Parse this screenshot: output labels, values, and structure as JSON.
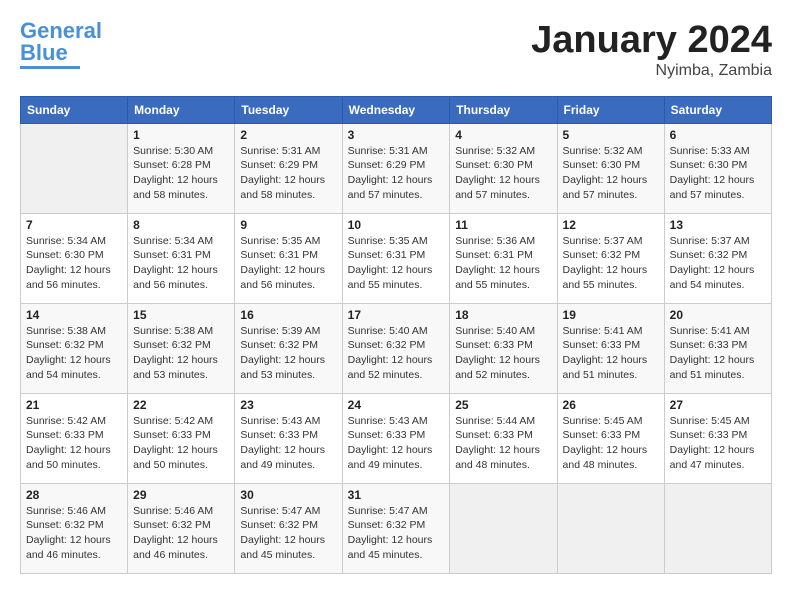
{
  "logo": {
    "line1": "General",
    "line2": "Blue"
  },
  "title": "January 2024",
  "subtitle": "Nyimba, Zambia",
  "headers": [
    "Sunday",
    "Monday",
    "Tuesday",
    "Wednesday",
    "Thursday",
    "Friday",
    "Saturday"
  ],
  "weeks": [
    [
      {
        "day": "",
        "info": ""
      },
      {
        "day": "1",
        "info": "Sunrise: 5:30 AM\nSunset: 6:28 PM\nDaylight: 12 hours\nand 58 minutes."
      },
      {
        "day": "2",
        "info": "Sunrise: 5:31 AM\nSunset: 6:29 PM\nDaylight: 12 hours\nand 58 minutes."
      },
      {
        "day": "3",
        "info": "Sunrise: 5:31 AM\nSunset: 6:29 PM\nDaylight: 12 hours\nand 57 minutes."
      },
      {
        "day": "4",
        "info": "Sunrise: 5:32 AM\nSunset: 6:30 PM\nDaylight: 12 hours\nand 57 minutes."
      },
      {
        "day": "5",
        "info": "Sunrise: 5:32 AM\nSunset: 6:30 PM\nDaylight: 12 hours\nand 57 minutes."
      },
      {
        "day": "6",
        "info": "Sunrise: 5:33 AM\nSunset: 6:30 PM\nDaylight: 12 hours\nand 57 minutes."
      }
    ],
    [
      {
        "day": "7",
        "info": "Sunrise: 5:34 AM\nSunset: 6:30 PM\nDaylight: 12 hours\nand 56 minutes."
      },
      {
        "day": "8",
        "info": "Sunrise: 5:34 AM\nSunset: 6:31 PM\nDaylight: 12 hours\nand 56 minutes."
      },
      {
        "day": "9",
        "info": "Sunrise: 5:35 AM\nSunset: 6:31 PM\nDaylight: 12 hours\nand 56 minutes."
      },
      {
        "day": "10",
        "info": "Sunrise: 5:35 AM\nSunset: 6:31 PM\nDaylight: 12 hours\nand 55 minutes."
      },
      {
        "day": "11",
        "info": "Sunrise: 5:36 AM\nSunset: 6:31 PM\nDaylight: 12 hours\nand 55 minutes."
      },
      {
        "day": "12",
        "info": "Sunrise: 5:37 AM\nSunset: 6:32 PM\nDaylight: 12 hours\nand 55 minutes."
      },
      {
        "day": "13",
        "info": "Sunrise: 5:37 AM\nSunset: 6:32 PM\nDaylight: 12 hours\nand 54 minutes."
      }
    ],
    [
      {
        "day": "14",
        "info": "Sunrise: 5:38 AM\nSunset: 6:32 PM\nDaylight: 12 hours\nand 54 minutes."
      },
      {
        "day": "15",
        "info": "Sunrise: 5:38 AM\nSunset: 6:32 PM\nDaylight: 12 hours\nand 53 minutes."
      },
      {
        "day": "16",
        "info": "Sunrise: 5:39 AM\nSunset: 6:32 PM\nDaylight: 12 hours\nand 53 minutes."
      },
      {
        "day": "17",
        "info": "Sunrise: 5:40 AM\nSunset: 6:32 PM\nDaylight: 12 hours\nand 52 minutes."
      },
      {
        "day": "18",
        "info": "Sunrise: 5:40 AM\nSunset: 6:33 PM\nDaylight: 12 hours\nand 52 minutes."
      },
      {
        "day": "19",
        "info": "Sunrise: 5:41 AM\nSunset: 6:33 PM\nDaylight: 12 hours\nand 51 minutes."
      },
      {
        "day": "20",
        "info": "Sunrise: 5:41 AM\nSunset: 6:33 PM\nDaylight: 12 hours\nand 51 minutes."
      }
    ],
    [
      {
        "day": "21",
        "info": "Sunrise: 5:42 AM\nSunset: 6:33 PM\nDaylight: 12 hours\nand 50 minutes."
      },
      {
        "day": "22",
        "info": "Sunrise: 5:42 AM\nSunset: 6:33 PM\nDaylight: 12 hours\nand 50 minutes."
      },
      {
        "day": "23",
        "info": "Sunrise: 5:43 AM\nSunset: 6:33 PM\nDaylight: 12 hours\nand 49 minutes."
      },
      {
        "day": "24",
        "info": "Sunrise: 5:43 AM\nSunset: 6:33 PM\nDaylight: 12 hours\nand 49 minutes."
      },
      {
        "day": "25",
        "info": "Sunrise: 5:44 AM\nSunset: 6:33 PM\nDaylight: 12 hours\nand 48 minutes."
      },
      {
        "day": "26",
        "info": "Sunrise: 5:45 AM\nSunset: 6:33 PM\nDaylight: 12 hours\nand 48 minutes."
      },
      {
        "day": "27",
        "info": "Sunrise: 5:45 AM\nSunset: 6:33 PM\nDaylight: 12 hours\nand 47 minutes."
      }
    ],
    [
      {
        "day": "28",
        "info": "Sunrise: 5:46 AM\nSunset: 6:32 PM\nDaylight: 12 hours\nand 46 minutes."
      },
      {
        "day": "29",
        "info": "Sunrise: 5:46 AM\nSunset: 6:32 PM\nDaylight: 12 hours\nand 46 minutes."
      },
      {
        "day": "30",
        "info": "Sunrise: 5:47 AM\nSunset: 6:32 PM\nDaylight: 12 hours\nand 45 minutes."
      },
      {
        "day": "31",
        "info": "Sunrise: 5:47 AM\nSunset: 6:32 PM\nDaylight: 12 hours\nand 45 minutes."
      },
      {
        "day": "",
        "info": ""
      },
      {
        "day": "",
        "info": ""
      },
      {
        "day": "",
        "info": ""
      }
    ]
  ]
}
